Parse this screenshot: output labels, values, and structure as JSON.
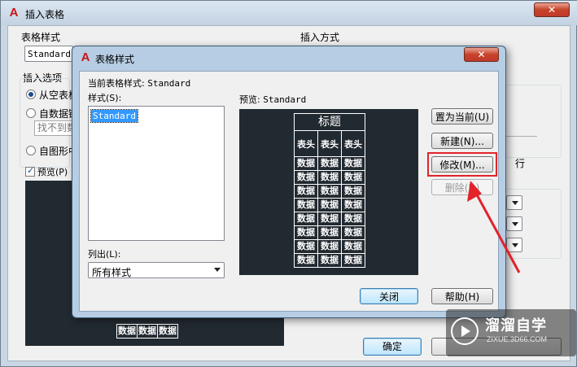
{
  "outer": {
    "title": "插入表格",
    "table_style_label": "表格样式",
    "table_style_value": "Standard",
    "insert_options_label": "插入选项",
    "opt_empty": "从空表格",
    "opt_data": "自数据链",
    "opt_data_sub": "找不到数",
    "opt_drawing": "自图形中",
    "preview_check": "预览(P)",
    "insert_method_label": "插入方式",
    "row_label": "行",
    "ok": "确定",
    "preview_table": [
      "数据",
      "数据",
      "数据"
    ]
  },
  "dialog": {
    "title": "表格样式",
    "current_style_label": "当前表格样式:",
    "current_style_value": "Standard",
    "styles_label": "样式(S):",
    "styles": [
      "Standard"
    ],
    "preview_label": "预览:",
    "preview_value": "Standard",
    "list_label": "列出(L):",
    "list_value": "所有样式",
    "buttons": {
      "set_current": "置为当前(U)",
      "new": "新建(N)...",
      "modify": "修改(M)...",
      "delete": "删除(D)",
      "close": "关闭",
      "help": "帮助(H)"
    },
    "preview_table": {
      "title": "标题",
      "headers": [
        "表头",
        "表头",
        "表头"
      ],
      "rows": [
        [
          "数据",
          "数据",
          "数据"
        ],
        [
          "数据",
          "数据",
          "数据"
        ],
        [
          "数据",
          "数据",
          "数据"
        ],
        [
          "数据",
          "数据",
          "数据"
        ],
        [
          "数据",
          "数据",
          "数据"
        ],
        [
          "数据",
          "数据",
          "数据"
        ],
        [
          "数据",
          "数据",
          "数据"
        ],
        [
          "数据",
          "数据",
          "数据"
        ]
      ]
    }
  },
  "watermark": {
    "brand": "溜溜自学",
    "url": "ZIXUE.3D66.COM"
  },
  "colors": {
    "accent": "#e2232a",
    "preview_bg": "#222a31",
    "selection": "#3399ff"
  }
}
